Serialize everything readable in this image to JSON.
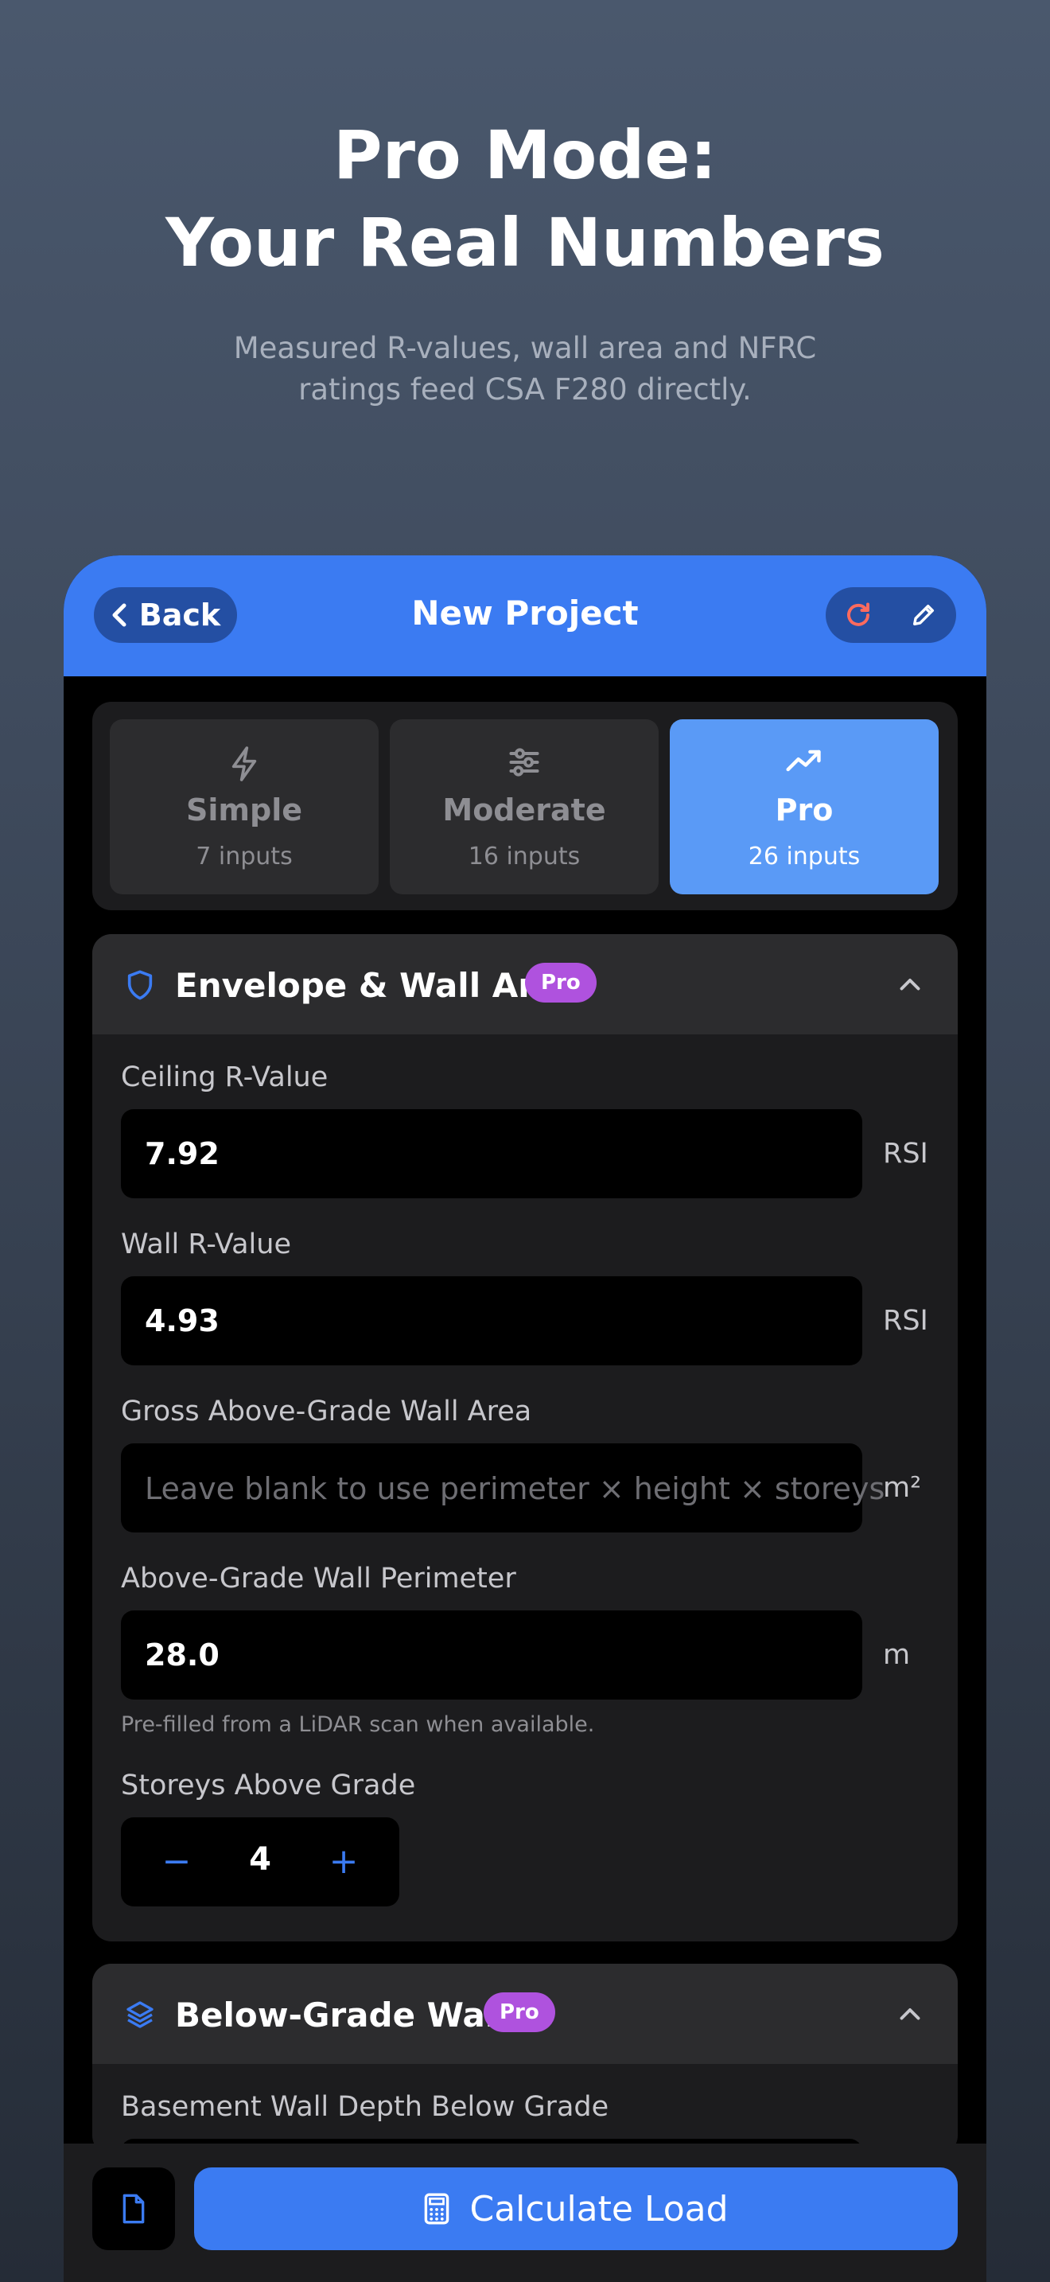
{
  "hero": {
    "title_line1": "Pro Mode:",
    "title_line2": "Your Real Numbers",
    "subtitle_line1": "Measured R-values, wall area and NFRC",
    "subtitle_line2": "ratings feed CSA F280 directly."
  },
  "nav": {
    "back_label": "Back",
    "title": "New Project",
    "icons": [
      "chevron-left-icon",
      "refresh-icon",
      "pencil-icon"
    ]
  },
  "modes": [
    {
      "label": "Simple",
      "count": "7 inputs",
      "icon": "lightning-icon",
      "active": false
    },
    {
      "label": "Moderate",
      "count": "16 inputs",
      "icon": "sliders-icon",
      "active": false
    },
    {
      "label": "Pro",
      "count": "26 inputs",
      "icon": "trending-up-icon",
      "active": true
    }
  ],
  "envelope": {
    "title": "Envelope & Wall Area",
    "badge": "Pro",
    "icon": "shield-icon",
    "ceiling": {
      "label": "Ceiling R-Value",
      "value": "7.92",
      "unit": "RSI"
    },
    "wall": {
      "label": "Wall R-Value",
      "value": "4.93",
      "unit": "RSI"
    },
    "gross_area": {
      "label": "Gross Above-Grade Wall Area",
      "placeholder": "Leave blank to use perimeter × height × storeys",
      "value": "",
      "unit": "m²"
    },
    "perimeter": {
      "label": "Above-Grade Wall Perimeter",
      "value": "28.0",
      "unit": "m",
      "hint": "Pre-filled from a LiDAR scan when available."
    },
    "storeys": {
      "label": "Storeys Above Grade",
      "value": 4,
      "minus": "−",
      "plus": "+"
    }
  },
  "below_grade": {
    "title": "Below-Grade Walls",
    "badge": "Pro",
    "icon": "layers-icon",
    "depth_label": "Basement Wall Depth Below Grade"
  },
  "bottom": {
    "calculate_label": "Calculate Load",
    "icons": [
      "document-icon",
      "calculator-icon"
    ]
  },
  "colors": {
    "accent": "#3b7bf2",
    "active_mode": "#5a9af6",
    "pro_badge": "#af52de",
    "refresh": "#ff6b5e"
  }
}
